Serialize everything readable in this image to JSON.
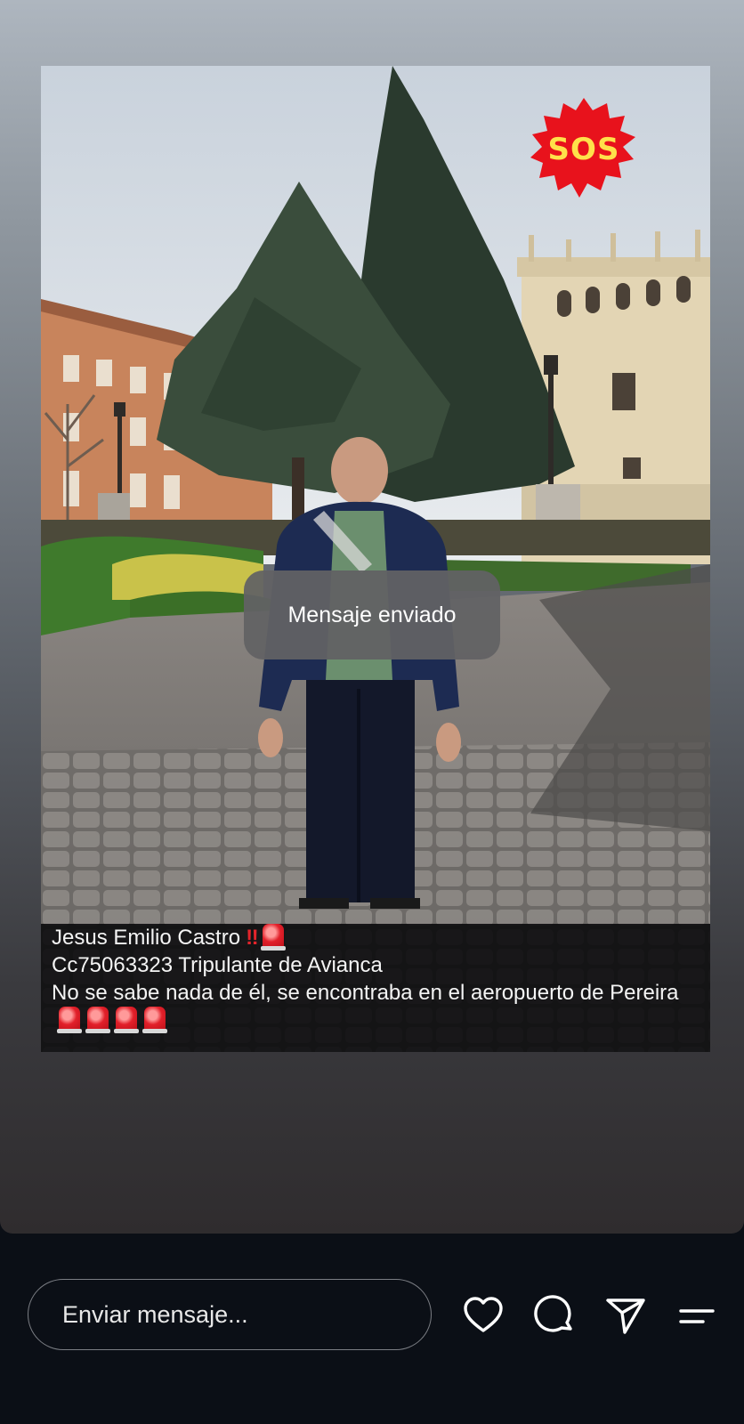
{
  "story": {
    "sos_label": "SOS",
    "caption": {
      "line1": "Jesus Emilio Castro",
      "line1_marks": "‼",
      "line2": "Cc75063323 Tripulante de Avianca",
      "line3": "No se sabe nada de él, se encontraba en el aeropuerto de Pereira"
    },
    "toast": "Mensaje enviado"
  },
  "composer": {
    "placeholder": "Enviar mensaje..."
  },
  "actions": [
    {
      "icon": "heart-icon"
    },
    {
      "icon": "comment-icon"
    },
    {
      "icon": "send-icon"
    },
    {
      "icon": "menu-icon"
    }
  ],
  "colors": {
    "sos_burst": "#e8121c",
    "sos_text": "#ffe14a",
    "toast_bg": "#626264",
    "bar_bg": "#0b0f16"
  }
}
